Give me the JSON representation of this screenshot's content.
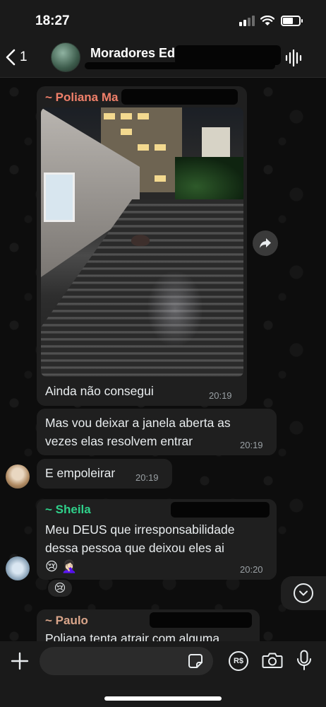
{
  "status_bar": {
    "time": "18:27"
  },
  "header": {
    "back_count": "1",
    "group_name": "Moradores Ed"
  },
  "messages": [
    {
      "sender": "~ Poliana Ma",
      "text": "Ainda não consegui",
      "time": "20:19",
      "has_photo": true
    },
    {
      "text": "Mas vou deixar a janela aberta as vezes elas resolvem entrar",
      "time": "20:19"
    },
    {
      "text": "E empoleirar",
      "time": "20:19"
    },
    {
      "sender": "~ Sheila",
      "text": "Meu DEUS que irresponsabilidade dessa pessoa que deixou eles ai",
      "emojis": "😢 🤦🏻‍♀️",
      "time": "20:20",
      "reaction": "😢"
    },
    {
      "sender": "~ Paulo",
      "text": "Poliana tenta atrair com alguma"
    }
  ],
  "input": {
    "pay_label": "R$"
  },
  "colors": {
    "poliana": "#f0806a",
    "sheila": "#2fd08a",
    "paulo": "#d9a58a",
    "bubble": "#1f1f1f"
  },
  "icons": [
    "chevron-left-icon",
    "waveform-icon",
    "forward-icon",
    "chevron-down-icon",
    "plus-icon",
    "sticker-icon",
    "camera-icon",
    "mic-icon"
  ]
}
